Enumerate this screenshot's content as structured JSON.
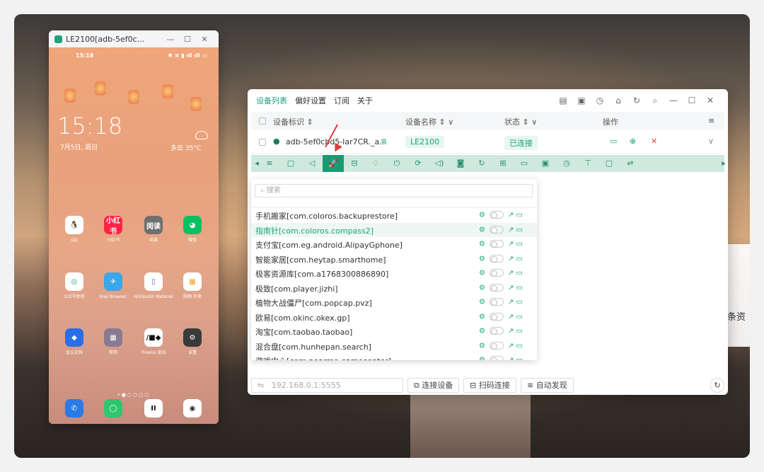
{
  "phone": {
    "window_title": "LE2100[adb-5ef0c...",
    "status_time": "15:18",
    "clock": "15:18",
    "date": "7月5日, 周日",
    "weather": "多云 35°C",
    "apps_row1": [
      {
        "label": "QQ",
        "color": "#e8453c"
      },
      {
        "label": "小红书",
        "color": "#ff2442"
      },
      {
        "label": "阅读",
        "color": "#6f6f6f"
      },
      {
        "label": "微信",
        "color": "#07c160"
      }
    ],
    "apps_row2": [
      {
        "label": "公众号助手",
        "color": "#1aa36a"
      },
      {
        "label": "Kiwi Browser",
        "color": "#3aa7e8"
      },
      {
        "label": "HiShoot2i Material",
        "color": "#5a6cc2"
      },
      {
        "label": "购物 外卖",
        "color": "#f0a020"
      }
    ],
    "apps_row3": [
      {
        "label": "金山文档",
        "color": "#2a6fe8"
      },
      {
        "label": "常用",
        "color": "#8a7a90"
      },
      {
        "label": "FlowUs 息流",
        "color": "#111111"
      },
      {
        "label": "设置",
        "color": "#3a3a3a"
      }
    ],
    "dock": [
      {
        "name": "phone",
        "color": "#2a7ae8"
      },
      {
        "name": "messages",
        "color": "#2ec66f"
      },
      {
        "name": "app",
        "color": "#ffffff"
      },
      {
        "name": "camera",
        "color": "#2a2a2a"
      }
    ],
    "page_dots": "•●○○○○"
  },
  "main": {
    "tabs": [
      "设备列表",
      "偏好设置",
      "订阅",
      "关于"
    ],
    "columns": {
      "id": "设备标识 ⇕",
      "name": "设备名称 ⇕ ∨",
      "status": "状态 ⇕ ∨",
      "ops": "操作"
    },
    "device": {
      "id": "adb-5ef0cbd5-lar7CR._a...",
      "name": "LE2100",
      "status": "已连接"
    },
    "search_placeholder": "搜索",
    "apps": [
      "手机搬家[com.coloros.backuprestore]",
      "指南针[com.coloros.compass2]",
      "支付宝[com.eg.android.AlipayGphone]",
      "智能家居[com.heytap.smarthome]",
      "极客资源库[com.a1768300886890]",
      "极致[com.player.jizhi]",
      "植物大战僵尸[com.popcap.pvz]",
      "欧易[com.okinc.okex.gp]",
      "淘宝[com.taobao.taobao]",
      "混合盘[com.hunhepan.search]",
      "游戏中心[com.nearme.gamecenter]"
    ],
    "highlighted_app": "指南针[com.coloros.compass2]",
    "address_placeholder": "192.168.0.1:5555",
    "buttons": {
      "connect": "连接设备",
      "scan": "扫码连接",
      "discover": "自动发现"
    }
  },
  "background": {
    "side_text": "条资"
  }
}
